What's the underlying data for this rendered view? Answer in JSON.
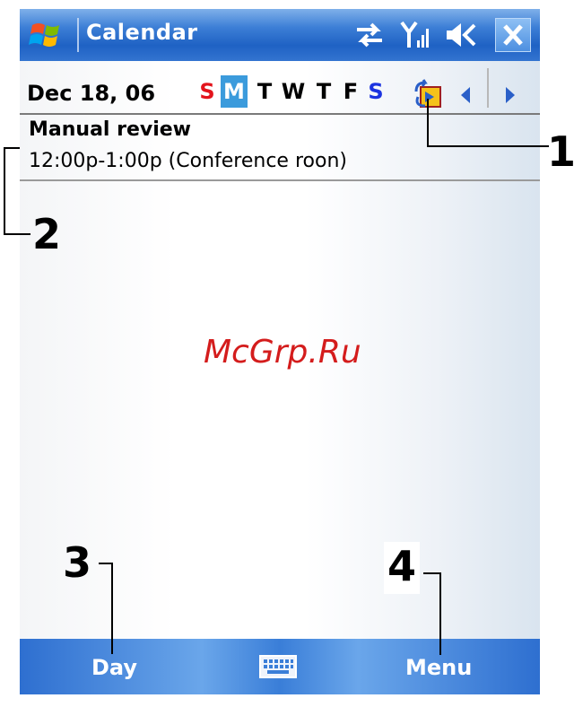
{
  "titlebar": {
    "title": "Calendar",
    "icons": [
      "windows-start-icon",
      "sync-arrows-icon",
      "signal-icon",
      "volume-muted-icon",
      "close-icon"
    ],
    "accent": "#1f62c4"
  },
  "date_row": {
    "date": "Dec 18, 06",
    "weekdays": [
      {
        "label": "S",
        "color": "#e3141c"
      },
      {
        "label": "M",
        "color": "#ffffff",
        "selected": true
      },
      {
        "label": "T",
        "color": "#000000"
      },
      {
        "label": "W",
        "color": "#000000"
      },
      {
        "label": "T",
        "color": "#000000"
      },
      {
        "label": "F",
        "color": "#000000"
      },
      {
        "label": "S",
        "color": "#1c34e0"
      }
    ],
    "icons": [
      "today-icon",
      "arrow-left-icon",
      "arrow-right-icon"
    ]
  },
  "appointment": {
    "title": "Manual review",
    "detail": "12:00p-1:00p  (Conference roon)"
  },
  "watermark": "McGrp.Ru",
  "softkeys": {
    "left": "Day",
    "right": "Menu"
  },
  "callouts": [
    "1",
    "2",
    "3",
    "4"
  ]
}
